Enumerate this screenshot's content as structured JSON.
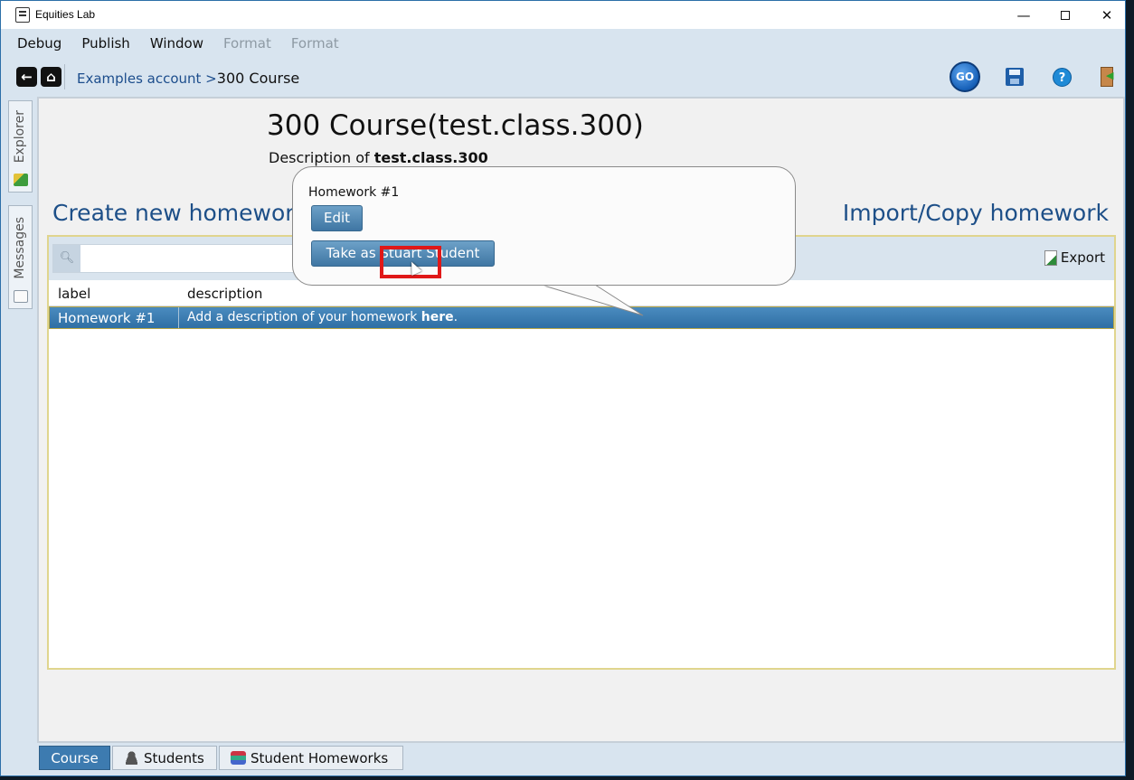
{
  "window": {
    "title": "Equities Lab"
  },
  "menu": {
    "items": [
      {
        "label": "Debug",
        "enabled": true
      },
      {
        "label": "Publish",
        "enabled": true
      },
      {
        "label": "Window",
        "enabled": true
      },
      {
        "label": "Format",
        "enabled": false
      },
      {
        "label": "Format",
        "enabled": false
      }
    ]
  },
  "toolbar": {
    "breadcrumb": {
      "link": "Examples account >",
      "current": "300 Course"
    },
    "go_label": "GO",
    "help_label": "?"
  },
  "sidebar": {
    "explorer_label": "Explorer",
    "messages_label": "Messages"
  },
  "course": {
    "title": "300 Course(test.class.300)",
    "description_prefix": "Description of",
    "description_value": "test.class.300",
    "create_label": "Create new homework",
    "import_label": "Import/Copy homework"
  },
  "grid": {
    "search_value": "",
    "export_label": "Export",
    "columns": {
      "label": "label",
      "description": "description"
    },
    "rows": [
      {
        "label": "Homework #1",
        "description_text": "Add a description of your homework",
        "description_link": "here",
        "description_end": "."
      }
    ]
  },
  "popup": {
    "title": "Homework #1",
    "edit_label": "Edit",
    "take_label": "Take as Stuart Student"
  },
  "bottom_tabs": {
    "course": "Course",
    "students": "Students",
    "student_homeworks": "Student Homeworks"
  },
  "colors": {
    "accent": "#3d7bb0",
    "link": "#1d4f88",
    "highlight": "#e01818"
  }
}
